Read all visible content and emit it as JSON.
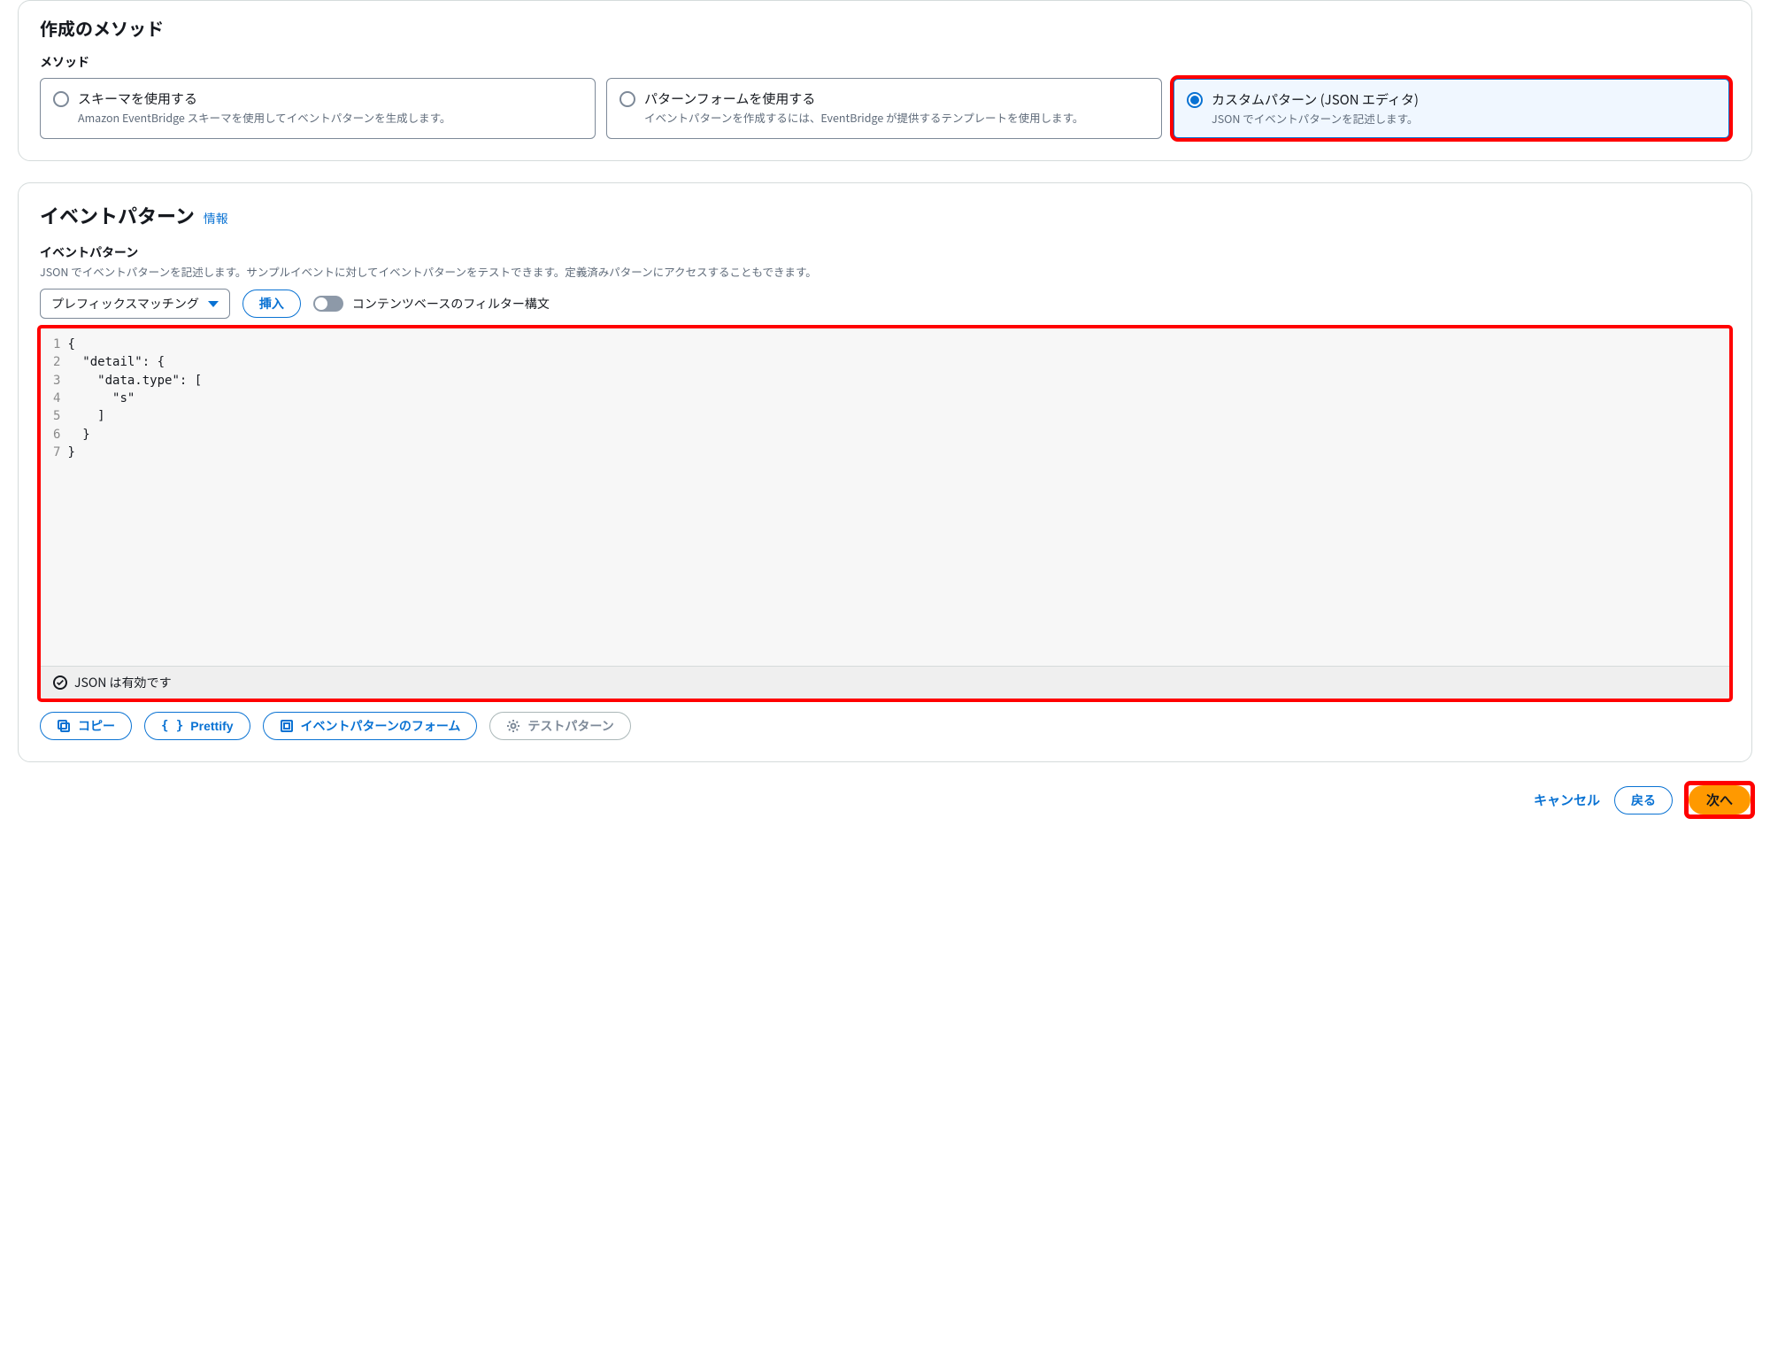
{
  "creation": {
    "section_title": "作成のメソッド",
    "method_label": "メソッド",
    "options": [
      {
        "title": "スキーマを使用する",
        "desc": "Amazon EventBridge スキーマを使用してイベントパターンを生成します。"
      },
      {
        "title": "パターンフォームを使用する",
        "desc": "イベントパターンを作成するには、EventBridge が提供するテンプレートを使用します。"
      },
      {
        "title": "カスタムパターン (JSON エディタ)",
        "desc": "JSON でイベントパターンを記述します。"
      }
    ],
    "selected": 2
  },
  "pattern": {
    "title": "イベントパターン",
    "info": "情報",
    "field_label": "イベントパターン",
    "field_desc": "JSON でイベントパターンを記述します。サンプルイベントに対してイベントパターンをテストできます。定義済みパターンにアクセスすることもできます。",
    "dropdown": "プレフィックスマッチング",
    "insert_btn": "挿入",
    "toggle_label": "コンテンツベースのフィルター構文",
    "code_lines": [
      "{",
      "  \"detail\": {",
      "    \"data.type\": [",
      "      \"s\"",
      "    ]",
      "  }",
      "}"
    ],
    "valid_msg": "JSON は有効です",
    "actions": {
      "copy": "コピー",
      "prettify": "Prettify",
      "form": "イベントパターンのフォーム",
      "test": "テストパターン"
    }
  },
  "footer": {
    "cancel": "キャンセル",
    "back": "戻る",
    "next": "次へ"
  }
}
